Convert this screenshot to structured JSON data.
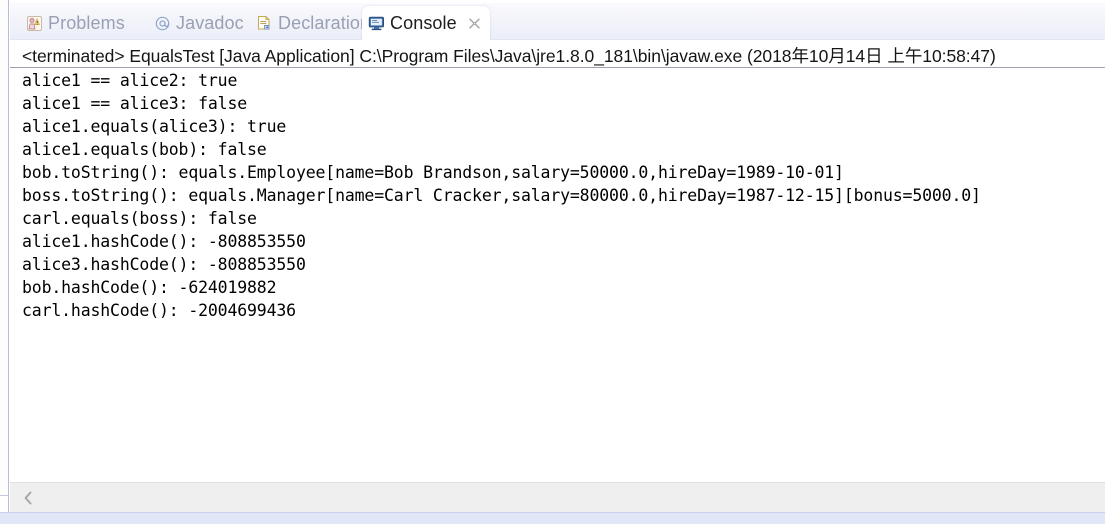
{
  "window": {
    "view_name": "Console"
  },
  "tabs": [
    {
      "id": "problems",
      "label": "Problems",
      "icon": "problems-icon",
      "active": false,
      "closable": false
    },
    {
      "id": "javadoc",
      "label": "Javadoc",
      "icon": "javadoc-at-icon",
      "active": false,
      "closable": false
    },
    {
      "id": "declaration",
      "label": "Declaration",
      "icon": "declaration-icon",
      "active": false,
      "closable": false
    },
    {
      "id": "console",
      "label": "Console",
      "icon": "console-monitor-icon",
      "active": true,
      "closable": true
    }
  ],
  "launch_header": {
    "status": "<terminated>",
    "config_name": "EqualsTest",
    "launch_type": "[Java Application]",
    "jvm_path": "C:\\Program Files\\Java\\jre1.8.0_181\\bin\\javaw.exe",
    "timestamp": "(2018年10月14日 上午10:58:47)",
    "full_text": "<terminated> EqualsTest [Java Application] C:\\Program Files\\Java\\jre1.8.0_181\\bin\\javaw.exe (2018年10月14日 上午10:58:47)"
  },
  "console": {
    "lines": [
      "alice1 == alice2: true",
      "alice1 == alice3: false",
      "alice1.equals(alice3): true",
      "alice1.equals(bob): false",
      "bob.toString(): equals.Employee[name=Bob Brandson,salary=50000.0,hireDay=1989-10-01]",
      "boss.toString(): equals.Manager[name=Carl Cracker,salary=80000.0,hireDay=1987-12-15][bonus=5000.0]",
      "carl.equals(boss): false",
      "alice1.hashCode(): -808853550",
      "alice3.hashCode(): -808853550",
      "bob.hashCode(): -624019882",
      "carl.hashCode(): -2004699436"
    ],
    "text": "alice1 == alice2: true\nalice1 == alice3: false\nalice1.equals(alice3): true\nalice1.equals(bob): false\nbob.toString(): equals.Employee[name=Bob Brandson,salary=50000.0,hireDay=1989-10-01]\nboss.toString(): equals.Manager[name=Carl Cracker,salary=80000.0,hireDay=1987-12-15][bonus=5000.0]\ncarl.equals(boss): false\nalice1.hashCode(): -808853550\nalice3.hashCode(): -808853550\nbob.hashCode(): -624019882\ncarl.hashCode(): -2004699436"
  },
  "scrollbar": {
    "left_arrow_glyph": "‹",
    "orientation": "horizontal"
  },
  "colors": {
    "tab_bar_background": "#f2f3fa",
    "active_tab_background": "#ffffff",
    "inactive_tab_text": "#9aa0b4",
    "active_tab_text": "#1c1c1c",
    "console_text": "#000000",
    "console_background": "#ffffff",
    "header_rule": "#9fa3ad",
    "scrollbar_track": "#efefef",
    "status_strip": "#e2e7f7"
  }
}
